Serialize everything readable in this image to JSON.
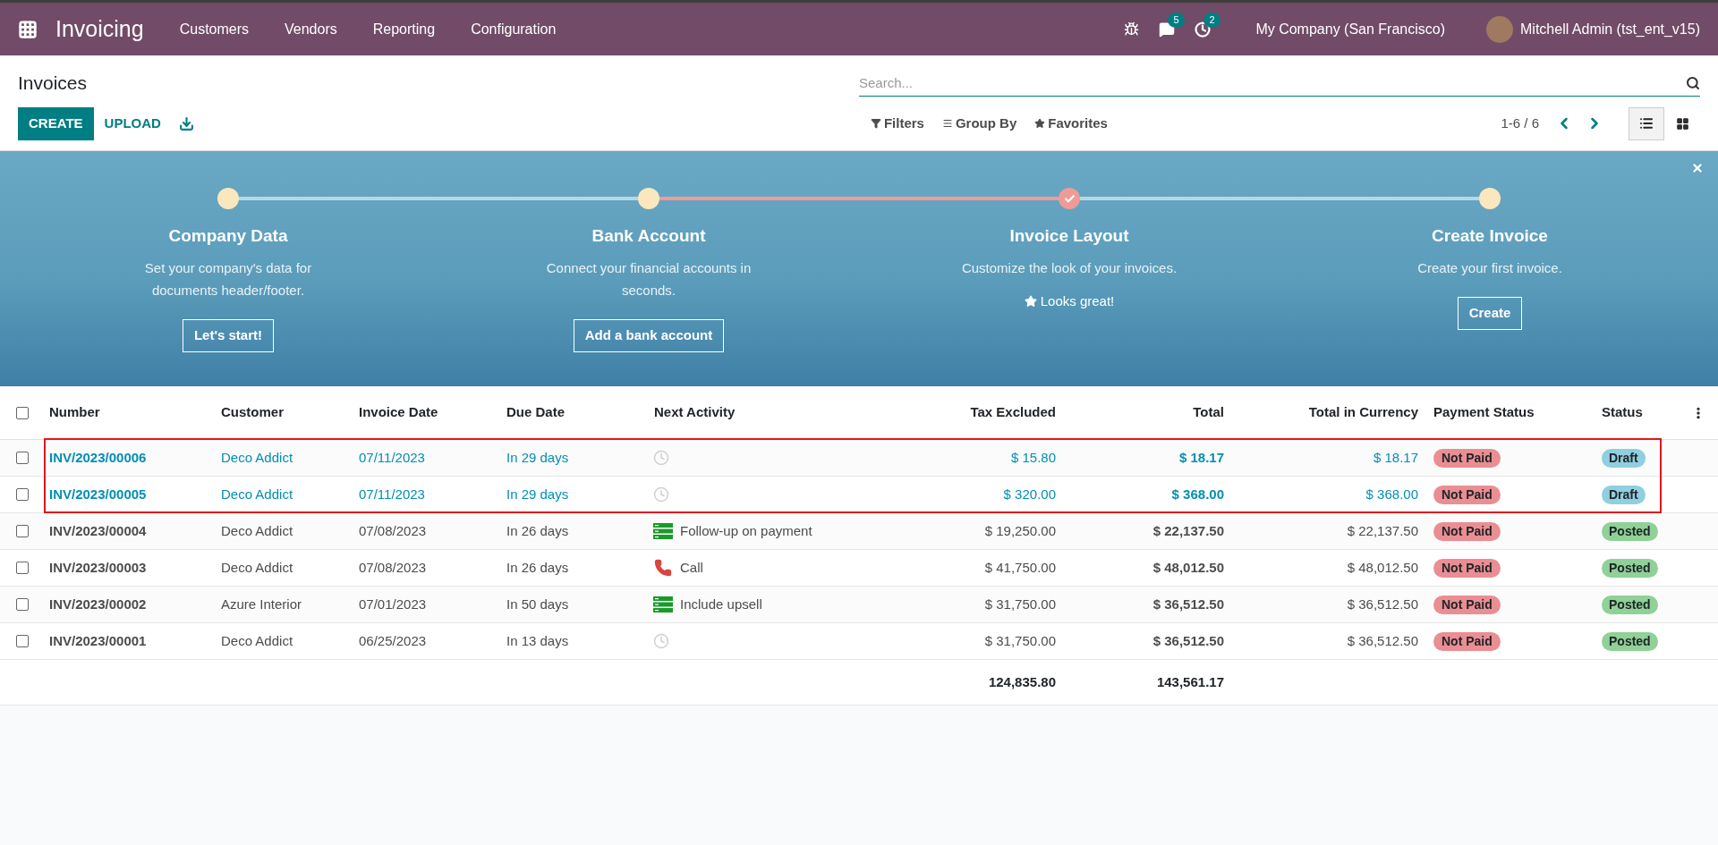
{
  "navbar": {
    "app_name": "Invoicing",
    "menu": [
      "Customers",
      "Vendors",
      "Reporting",
      "Configuration"
    ],
    "messages_count": "5",
    "activities_count": "2",
    "company": "My Company (San Francisco)",
    "user": "Mitchell Admin (tst_ent_v15)"
  },
  "control_panel": {
    "breadcrumb": "Invoices",
    "search": {
      "placeholder": "Search..."
    },
    "create_label": "CREATE",
    "upload_label": "UPLOAD",
    "filters": [
      "Filters",
      "Group By",
      "Favorites"
    ],
    "pager": "1-6 / 6",
    "views": [
      {
        "kind": "list",
        "selected": true
      },
      {
        "kind": "kanban",
        "selected": false
      }
    ]
  },
  "onboarding": {
    "steps": [
      {
        "title": "Company Data",
        "description": "Set your company's data for documents header/footer.",
        "done": false,
        "action": "Let's start!"
      },
      {
        "title": "Bank Account",
        "description": "Connect your financial accounts in seconds.",
        "done": false,
        "action": "Add a bank account"
      },
      {
        "title": "Invoice Layout",
        "description": "Customize the look of your invoices.",
        "done": true,
        "done_text": "Looks great!"
      },
      {
        "title": "Create Invoice",
        "description": "Create your first invoice.",
        "done": false,
        "action": "Create"
      }
    ]
  },
  "table": {
    "all_checked": false,
    "columns": [
      "Number",
      "Customer",
      "Invoice Date",
      "Due Date",
      "Next Activity",
      "Tax Excluded",
      "Total",
      "Total in Currency",
      "Payment Status",
      "Status"
    ],
    "rows": [
      {
        "checked": false,
        "highlighted": true,
        "kind": "draft",
        "number": "INV/2023/00006",
        "customer": "Deco Addict",
        "invoice_date": "07/11/2023",
        "due_date": "In 29 days",
        "activity": {
          "kind": "none"
        },
        "tax_excluded": "$ 15.80",
        "total": "$ 18.17",
        "total_currency": "$ 18.17",
        "payment_status": "Not Paid",
        "status": "Draft"
      },
      {
        "checked": false,
        "highlighted": true,
        "kind": "draft",
        "number": "INV/2023/00005",
        "customer": "Deco Addict",
        "invoice_date": "07/11/2023",
        "due_date": "In 29 days",
        "activity": {
          "kind": "none"
        },
        "tax_excluded": "$ 320.00",
        "total": "$ 368.00",
        "total_currency": "$ 368.00",
        "payment_status": "Not Paid",
        "status": "Draft"
      },
      {
        "checked": false,
        "highlighted": false,
        "kind": "posted",
        "number": "INV/2023/00004",
        "customer": "Deco Addict",
        "invoice_date": "07/08/2023",
        "due_date": "In 26 days",
        "activity": {
          "kind": "todo",
          "label": "Follow-up on payment"
        },
        "tax_excluded": "$ 19,250.00",
        "total": "$ 22,137.50",
        "total_currency": "$ 22,137.50",
        "payment_status": "Not Paid",
        "status": "Posted"
      },
      {
        "checked": false,
        "highlighted": false,
        "kind": "posted",
        "number": "INV/2023/00003",
        "customer": "Deco Addict",
        "invoice_date": "07/08/2023",
        "due_date": "In 26 days",
        "activity": {
          "kind": "call",
          "label": "Call"
        },
        "tax_excluded": "$ 41,750.00",
        "total": "$ 48,012.50",
        "total_currency": "$ 48,012.50",
        "payment_status": "Not Paid",
        "status": "Posted"
      },
      {
        "checked": false,
        "highlighted": false,
        "kind": "posted",
        "number": "INV/2023/00002",
        "customer": "Azure Interior",
        "invoice_date": "07/01/2023",
        "due_date": "In 50 days",
        "activity": {
          "kind": "todo",
          "label": "Include upsell"
        },
        "tax_excluded": "$ 31,750.00",
        "total": "$ 36,512.50",
        "total_currency": "$ 36,512.50",
        "payment_status": "Not Paid",
        "status": "Posted"
      },
      {
        "checked": false,
        "highlighted": false,
        "kind": "posted",
        "number": "INV/2023/00001",
        "customer": "Deco Addict",
        "invoice_date": "06/25/2023",
        "due_date": "In 13 days",
        "activity": {
          "kind": "none"
        },
        "tax_excluded": "$ 31,750.00",
        "total": "$ 36,512.50",
        "total_currency": "$ 36,512.50",
        "payment_status": "Not Paid",
        "status": "Posted"
      }
    ],
    "totals": {
      "tax_excluded": "124,835.80",
      "total": "143,561.17"
    }
  }
}
